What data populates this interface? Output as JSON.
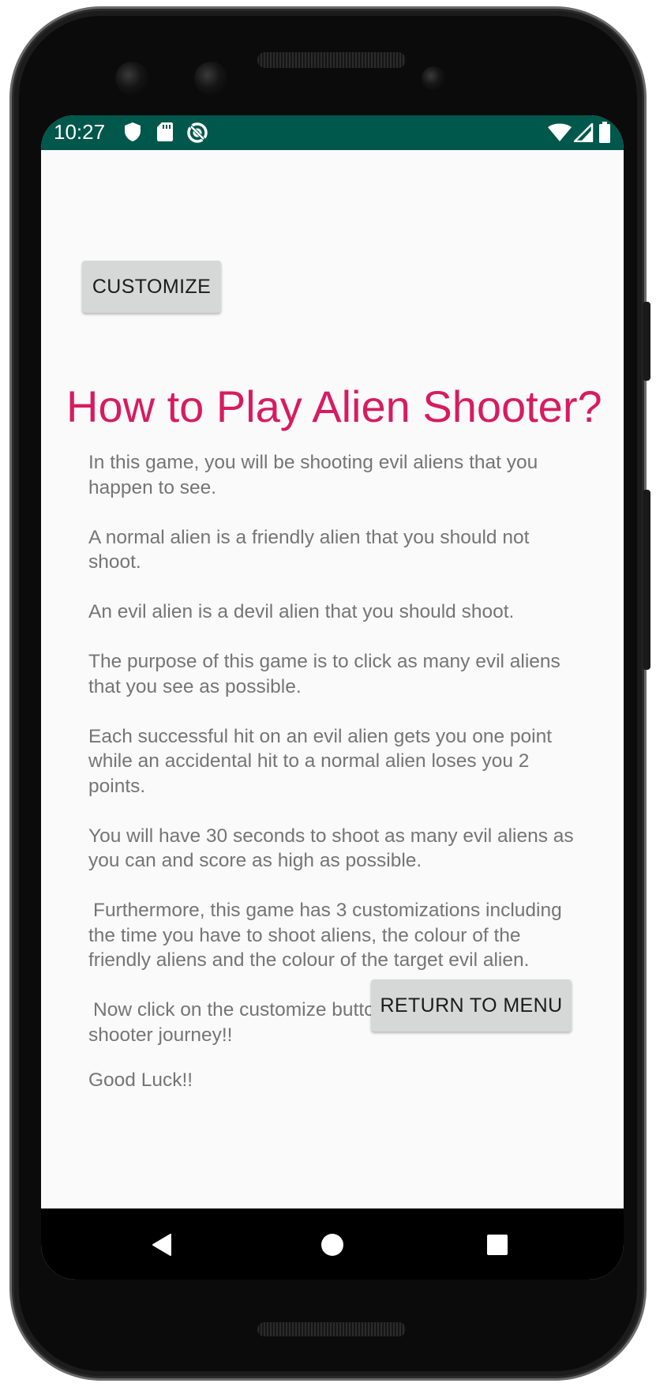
{
  "status_bar": {
    "time": "10:27",
    "left_icons": [
      "shield-icon",
      "sd-card-icon",
      "sync-icon"
    ],
    "right_icons": [
      "wifi-icon",
      "signal-icon",
      "battery-icon"
    ],
    "color": "#00574b"
  },
  "customize_button": {
    "label": "CUSTOMIZE"
  },
  "title": "How to Play Alien Shooter?",
  "instructions": [
    "In this game, you will be shooting evil aliens that you happen to see.",
    "A normal alien is a friendly alien that you should not shoot.",
    "An evil alien is a devil alien that you should shoot.",
    "The purpose of this game is to click as many evil aliens that you see as possible.",
    "Each successful hit on an evil alien gets you one point while an accidental hit to a normal alien loses you 2 points.",
    "You will have 30 seconds to shoot as many evil aliens as you can and score as high as possible.",
    "Furthermore, this game has 3 customizations including the time you have to shoot aliens, the colour of the friendly aliens and the colour of the target evil alien.",
    "Now click on the customize button to start your alien shooter journey!!",
    "Good Luck!!"
  ],
  "return_button": {
    "label": "RETURN TO MENU"
  },
  "nav_bar": {
    "icons": [
      "back-icon",
      "home-icon",
      "recents-icon"
    ]
  },
  "colors": {
    "accent": "#d81b60",
    "body_text": "#757575",
    "button_bg": "#d6d7d7",
    "screen_bg": "#fafafa"
  }
}
